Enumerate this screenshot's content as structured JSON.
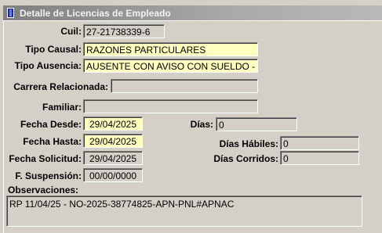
{
  "window": {
    "title": "Detalle de Licencias de  Empleado"
  },
  "form": {
    "cuil": {
      "label": "Cuil:",
      "value": "27-21738339-6"
    },
    "tipo_causal": {
      "label": "Tipo Causal:",
      "value": "RAZONES PARTICULARES"
    },
    "tipo_ausencia": {
      "label": "Tipo Ausencia:",
      "value": "AUSENTE CON AVISO CON SUELDO - A"
    },
    "carrera_relacionada": {
      "label": "Carrera Relacionada:",
      "value": ""
    },
    "familiar": {
      "label": "Familiar:",
      "value": ""
    },
    "fecha_desde": {
      "label": "Fecha Desde:",
      "value": "29/04/2025"
    },
    "fecha_hasta": {
      "label": "Fecha Hasta:",
      "value": "29/04/2025"
    },
    "fecha_solicitud": {
      "label": "Fecha Solicitud:",
      "value": "29/04/2025"
    },
    "f_suspension": {
      "label": "F. Suspensión:",
      "value": "00/00/0000"
    },
    "dias": {
      "label": "Días:",
      "value": "0"
    },
    "dias_habiles": {
      "label": "Días Hábiles:",
      "value": "0"
    },
    "dias_corridos": {
      "label": "Días Corridos:",
      "value": "0"
    },
    "observaciones": {
      "label": "Observaciones:",
      "value": "RP 11/04/25 - NO-2025-38774825-APN-PNL#APNAC"
    }
  },
  "colors": {
    "required_field_bg": "#ffffc0",
    "window_bg": "#d4d0c8"
  },
  "icons": {
    "title_icon": "form-window-icon"
  }
}
